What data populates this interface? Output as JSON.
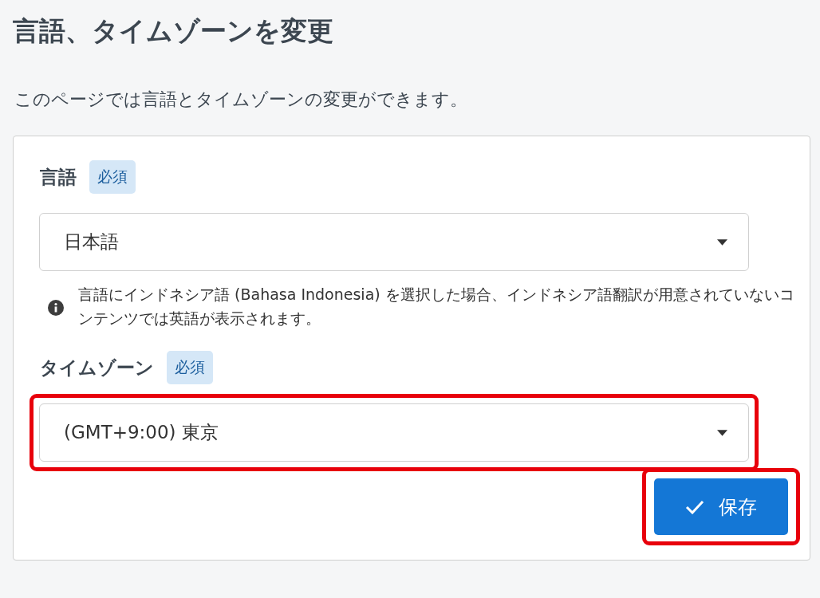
{
  "title": "言語、タイムゾーンを変更",
  "description": "このページでは言語とタイムゾーンの変更ができます。",
  "fields": [
    {
      "label": "言語",
      "badge": "必須",
      "value": "日本語",
      "highlighted": false,
      "note": "言語にインドネシア語 (Bahasa Indonesia) を選択した場合、インドネシア語翻訳が用意されていないコンテンツでは英語が表示されます。"
    },
    {
      "label": "タイムゾーン",
      "badge": "必須",
      "value": "(GMT+9:00) 東京",
      "highlighted": true
    }
  ],
  "save_button": {
    "label": "保存",
    "highlighted": true
  }
}
